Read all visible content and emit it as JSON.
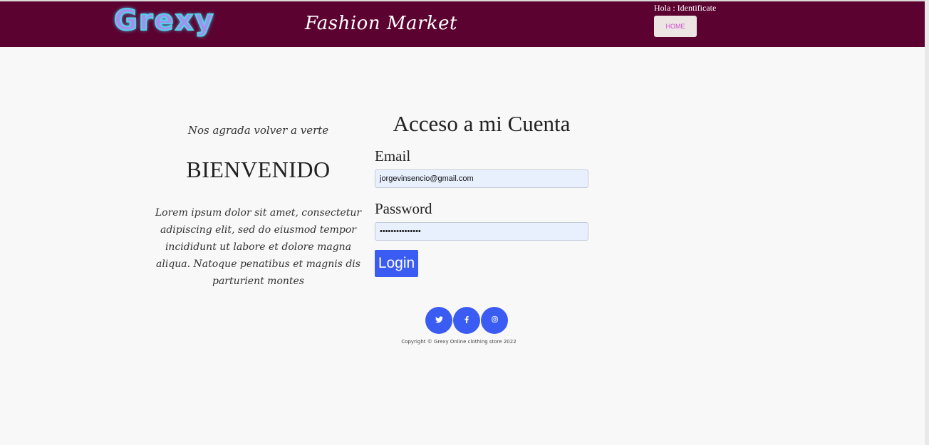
{
  "header": {
    "logo_text": "Grexy",
    "brand_name": "Fashion Market",
    "greeting": "Hola : Identificate",
    "home_label": "HOME"
  },
  "welcome": {
    "tagline": "Nos agrada volver a verte",
    "title": "BIENVENIDO",
    "body": "Lorem ipsum dolor sit amet, consectetur adipiscing elit, sed do eiusmod tempor incididunt ut labore et dolore magna aliqua. Natoque penatibus et magnis dis parturient montes"
  },
  "login_form": {
    "title": "Acceso a mi Cuenta",
    "email_label": "Email",
    "email_value": "jorgevinsencio@gmail.com",
    "password_label": "Password",
    "password_value": "•••••••••••••••",
    "submit_label": "Login"
  },
  "footer": {
    "social": [
      {
        "name": "twitter-icon",
        "glyph": "🐦"
      },
      {
        "name": "facebook-icon",
        "glyph": "f"
      },
      {
        "name": "instagram-icon",
        "glyph": "◎"
      }
    ],
    "copyright": "Copyright © Grexy Online clothing store 2022"
  },
  "colors": {
    "header_bg": "#5c0230",
    "accent_blue": "#3b5cf3",
    "page_bg": "#f9f8f9"
  }
}
